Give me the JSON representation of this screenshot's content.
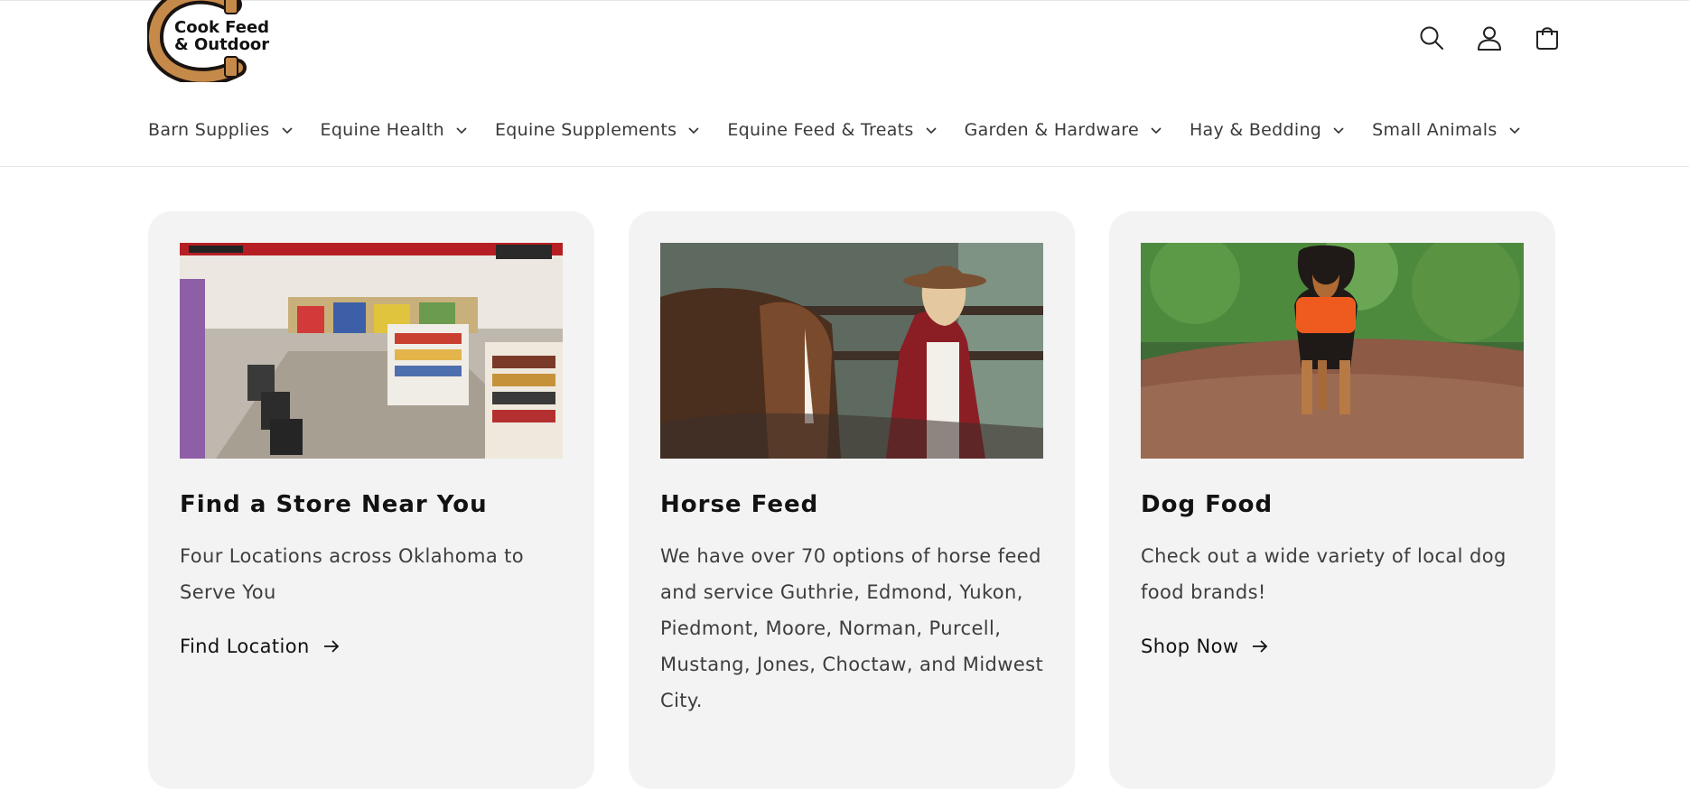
{
  "brand": {
    "logo_line1": "Cook Feed",
    "logo_line2": "& Outdoor"
  },
  "header": {
    "icons": [
      "search-icon",
      "account-icon",
      "cart-icon"
    ]
  },
  "nav": {
    "items": [
      {
        "label": "Barn Supplies"
      },
      {
        "label": "Equine Health"
      },
      {
        "label": "Equine Supplements"
      },
      {
        "label": "Equine Feed & Treats"
      },
      {
        "label": "Garden & Hardware"
      },
      {
        "label": "Hay & Bedding"
      },
      {
        "label": "Small Animals"
      }
    ]
  },
  "cards": [
    {
      "title": "Find a Store Near You",
      "text": "Four Locations across Oklahoma to Serve You",
      "link": "Find Location"
    },
    {
      "title": "Horse Feed",
      "text": "We have over 70 options of horse feed and service Guthrie, Edmond, Yukon, Piedmont, Moore, Norman, Purcell, Mustang, Jones, Choctaw, and Midwest City.",
      "link": ""
    },
    {
      "title": "Dog Food",
      "text": "Check out a wide variety of local dog food brands!",
      "link": "Shop Now"
    }
  ],
  "colors": {
    "card_bg": "#f3f3f3",
    "text": "#121212",
    "logo_ring": "#c58a4a"
  }
}
